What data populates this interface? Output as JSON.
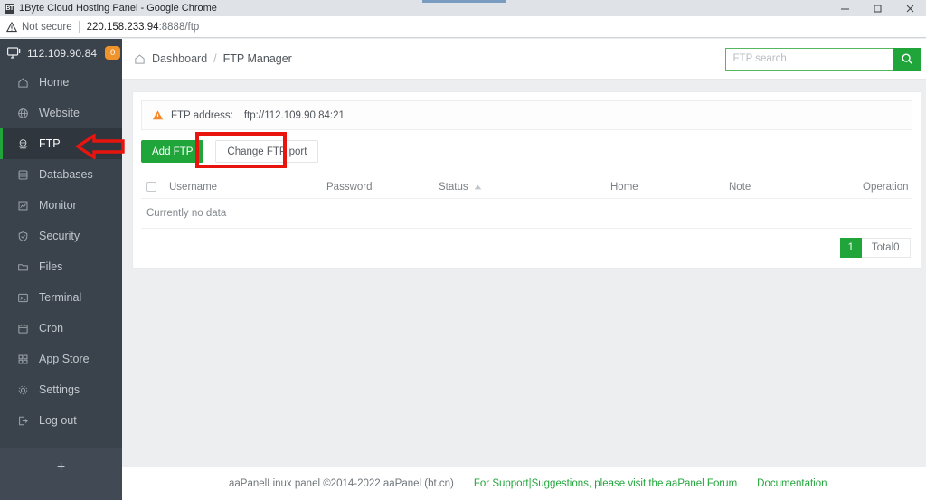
{
  "browser": {
    "tab_title": "1Byte Cloud Hosting Panel - Google Chrome",
    "favicon_text": "BT",
    "security_label": "Not secure",
    "url_host": "220.158.233.94",
    "url_path": ":8888/ftp",
    "minimize_label": "Minimize",
    "maximize_label": "Maximize",
    "close_label": "Close"
  },
  "sidebar": {
    "server_ip": "112.109.90.84",
    "badge_count": "0",
    "add_label": "+",
    "items": [
      {
        "label": "Home",
        "icon": "home-icon",
        "active": false
      },
      {
        "label": "Website",
        "icon": "globe-icon",
        "active": false
      },
      {
        "label": "FTP",
        "icon": "ftp-icon",
        "active": true
      },
      {
        "label": "Databases",
        "icon": "database-icon",
        "active": false
      },
      {
        "label": "Monitor",
        "icon": "monitor-chart-icon",
        "active": false
      },
      {
        "label": "Security",
        "icon": "shield-icon",
        "active": false
      },
      {
        "label": "Files",
        "icon": "folder-icon",
        "active": false
      },
      {
        "label": "Terminal",
        "icon": "terminal-icon",
        "active": false
      },
      {
        "label": "Cron",
        "icon": "calendar-icon",
        "active": false
      },
      {
        "label": "App Store",
        "icon": "grid-icon",
        "active": false
      },
      {
        "label": "Settings",
        "icon": "gear-icon",
        "active": false
      },
      {
        "label": "Log out",
        "icon": "logout-icon",
        "active": false
      }
    ]
  },
  "header": {
    "breadcrumb_root": "Dashboard",
    "breadcrumb_sep": "/",
    "breadcrumb_current": "FTP Manager",
    "search_placeholder": "FTP search",
    "search_value": ""
  },
  "notice": {
    "label": "FTP address:",
    "value": "ftp://112.109.90.84:21"
  },
  "toolbar": {
    "add_ftp_label": "Add FTP",
    "change_port_label": "Change FTP port"
  },
  "table": {
    "columns": {
      "username": "Username",
      "password": "Password",
      "status": "Status",
      "home": "Home",
      "note": "Note",
      "operation": "Operation"
    },
    "rows": [],
    "empty_text": "Currently no data"
  },
  "pagination": {
    "current_page": "1",
    "total_label": "Total0"
  },
  "footer": {
    "copyright": "aaPanelLinux panel ©2014-2022 aaPanel (bt.cn)",
    "support_link": "For Support|Suggestions, please visit the aaPanel Forum",
    "docs_link": "Documentation"
  },
  "colors": {
    "accent_green": "#20a53a",
    "sidebar_bg": "#3a424b",
    "badge_orange": "#f0932b",
    "annotation_red": "#e8150f"
  }
}
